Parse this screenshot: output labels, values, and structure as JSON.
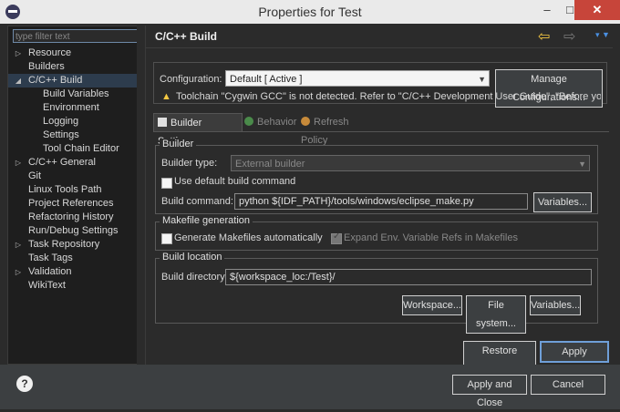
{
  "window": {
    "title": "Properties for Test",
    "min": "–",
    "max": "□",
    "close": "✕"
  },
  "filter": {
    "placeholder": "type filter text"
  },
  "tree": [
    {
      "label": "Resource",
      "arrow": "▷",
      "level": 0
    },
    {
      "label": "Builders",
      "arrow": "",
      "level": 0
    },
    {
      "label": "C/C++ Build",
      "arrow": "◢",
      "level": 0,
      "selected": true
    },
    {
      "label": "Build Variables",
      "arrow": "",
      "level": 1
    },
    {
      "label": "Environment",
      "arrow": "",
      "level": 1
    },
    {
      "label": "Logging",
      "arrow": "",
      "level": 1
    },
    {
      "label": "Settings",
      "arrow": "",
      "level": 1
    },
    {
      "label": "Tool Chain Editor",
      "arrow": "",
      "level": 1
    },
    {
      "label": "C/C++ General",
      "arrow": "▷",
      "level": 0
    },
    {
      "label": "Git",
      "arrow": "",
      "level": 0
    },
    {
      "label": "Linux Tools Path",
      "arrow": "",
      "level": 0
    },
    {
      "label": "Project References",
      "arrow": "",
      "level": 0
    },
    {
      "label": "Refactoring History",
      "arrow": "",
      "level": 0
    },
    {
      "label": "Run/Debug Settings",
      "arrow": "",
      "level": 0
    },
    {
      "label": "Task Repository",
      "arrow": "▷",
      "level": 0
    },
    {
      "label": "Task Tags",
      "arrow": "",
      "level": 0
    },
    {
      "label": "Validation",
      "arrow": "▷",
      "level": 0
    },
    {
      "label": "WikiText",
      "arrow": "",
      "level": 0
    }
  ],
  "page": {
    "title": "C/C++ Build"
  },
  "nav": {
    "back": "⇦",
    "forward": "⇨",
    "menu": "▾ ▼"
  },
  "config": {
    "label": "Configuration:",
    "value": "Default  [ Active ]",
    "manage_button": "Manage Configurations...",
    "warning": "Toolchain \"Cygwin GCC\" is not detected. Refer to \"C/C++ Development User Guide\", \"Before you begin\" h"
  },
  "tabs": [
    {
      "label": "Builder Settings",
      "active": true
    },
    {
      "label": "Behavior",
      "active": false
    },
    {
      "label": "Refresh Policy",
      "active": false
    }
  ],
  "builder": {
    "group_title": "Builder",
    "type_label": "Builder type:",
    "type_value": "External builder",
    "use_default_label": "Use default build command",
    "use_default_checked": false,
    "command_label": "Build command:",
    "command_value": "python ${IDF_PATH}/tools/windows/eclipse_make.py",
    "variables_button": "Variables..."
  },
  "makefile": {
    "group_title": "Makefile generation",
    "generate_label": "Generate Makefiles automatically",
    "generate_checked": false,
    "expand_label": "Expand Env. Variable Refs in Makefiles",
    "expand_checked": true
  },
  "location": {
    "group_title": "Build location",
    "dir_label": "Build directory:",
    "dir_value": "${workspace_loc:/Test}/",
    "workspace_button": "Workspace...",
    "filesystem_button": "File system...",
    "variables_button": "Variables..."
  },
  "actions": {
    "restore_defaults": "Restore Defaults",
    "apply": "Apply",
    "apply_close": "Apply and Close",
    "cancel": "Cancel",
    "help": "?"
  },
  "colors": {
    "accent": "#f5c842",
    "close": "#c7453a",
    "selection": "#2d3c4d"
  }
}
